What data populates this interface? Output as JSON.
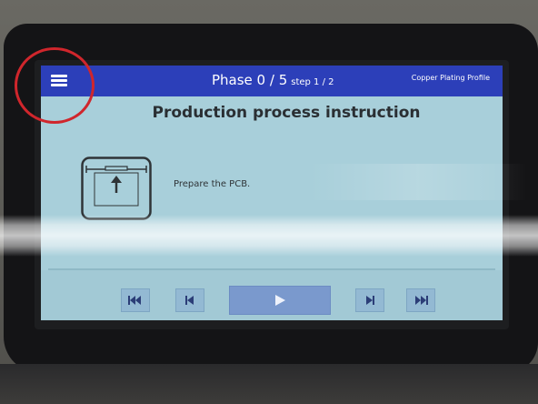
{
  "header": {
    "phase_label": "Phase 0 / 5",
    "step_label": "step 1 / 2",
    "profile_label": "Copper Plating Profile"
  },
  "main": {
    "title": "Production process instruction",
    "instruction_text": "Prepare the PCB."
  },
  "controls": {
    "buttons": [
      "skip-to-start",
      "previous-step",
      "play",
      "next-step",
      "skip-to-end"
    ]
  },
  "colors": {
    "header_bg": "#2c3fb9",
    "screen_bg": "#a8cfda",
    "button_bg": "#93b9d3",
    "play_bg": "#7a99cd",
    "annotation_circle": "#d0262c"
  }
}
